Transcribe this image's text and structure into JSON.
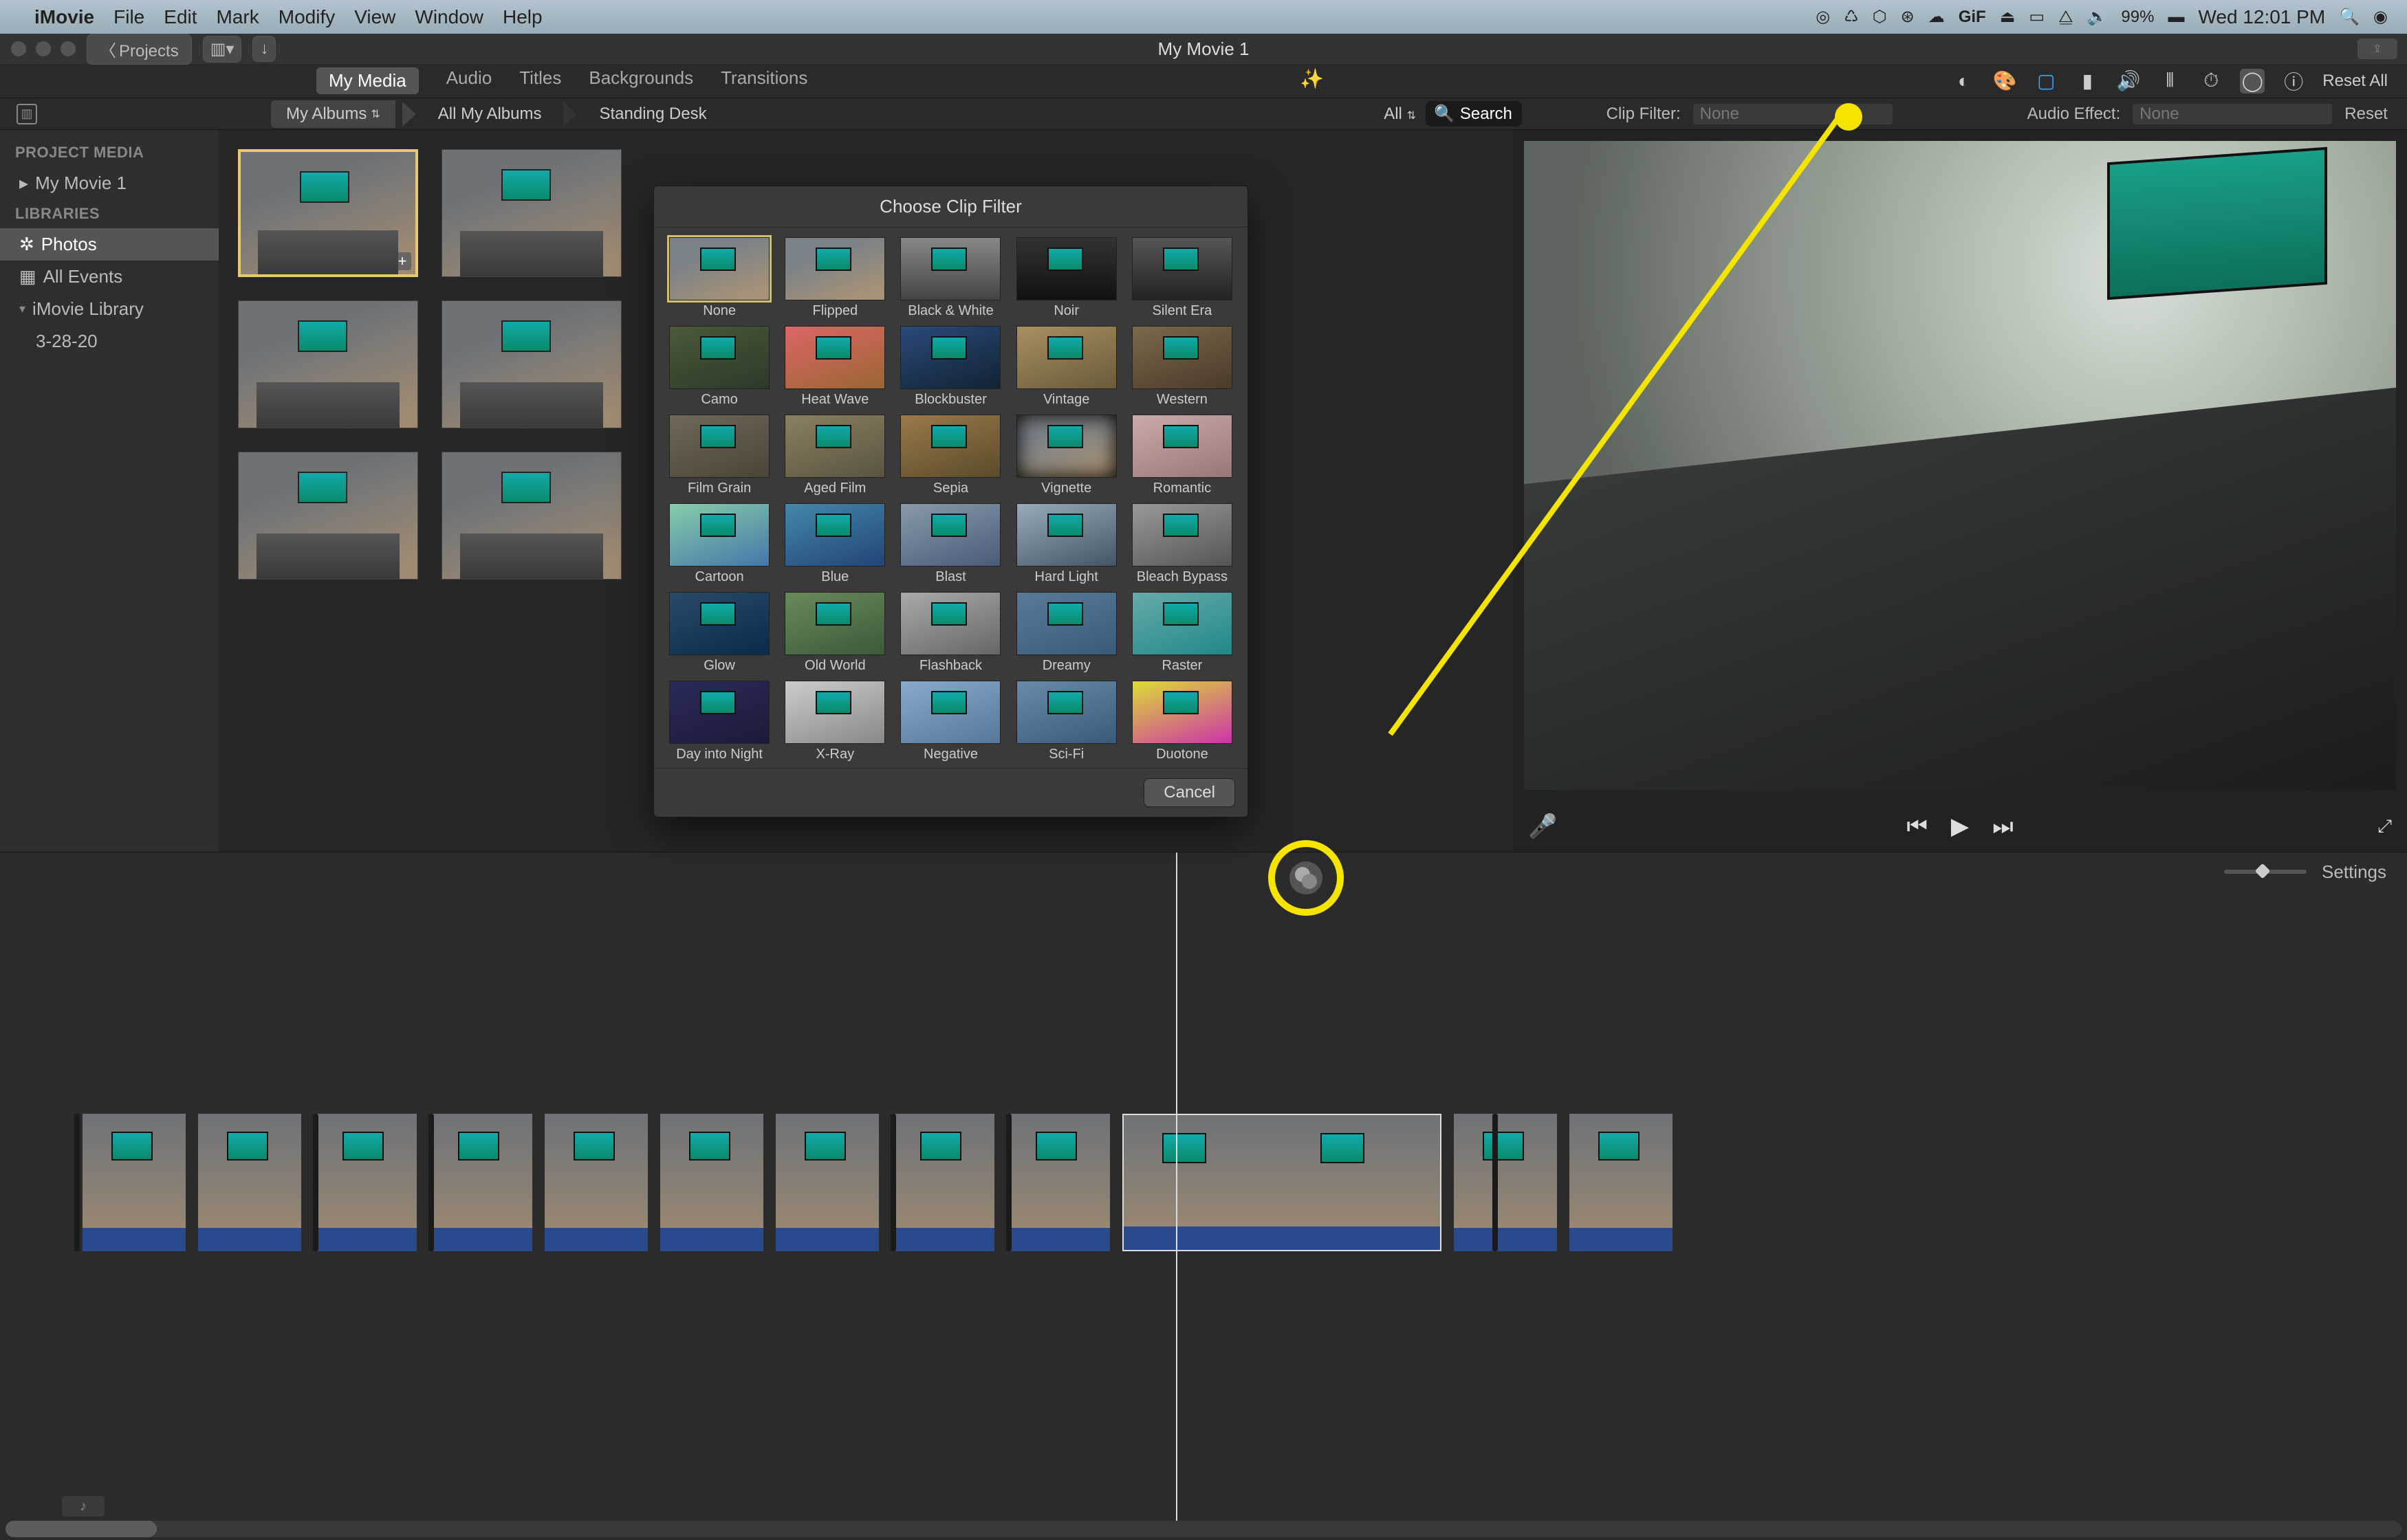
{
  "menubar": {
    "app": "iMovie",
    "items": [
      "File",
      "Edit",
      "Mark",
      "Modify",
      "View",
      "Window",
      "Help"
    ],
    "right": {
      "gif": "GiF",
      "battery": "99%",
      "clock": "Wed 12:01 PM"
    }
  },
  "titlebar": {
    "projects": "Projects",
    "title": "My Movie 1"
  },
  "tabs": [
    "My Media",
    "Audio",
    "Titles",
    "Backgrounds",
    "Transitions"
  ],
  "active_tab": "My Media",
  "reset_all": "Reset All",
  "breadcrumb": {
    "albums": "My Albums",
    "all": "All My Albums",
    "current": "Standing Desk",
    "filter": "All",
    "search_placeholder": "Search"
  },
  "fx": {
    "clip_label": "Clip Filter:",
    "clip_value": "None",
    "audio_label": "Audio Effect:",
    "audio_value": "None",
    "reset": "Reset"
  },
  "sidebar": {
    "project_media_hd": "PROJECT MEDIA",
    "project": "My Movie 1",
    "libraries_hd": "LIBRARIES",
    "photos": "Photos",
    "all_events": "All Events",
    "imovie_lib": "iMovie Library",
    "event": "3-28-20"
  },
  "modal": {
    "title": "Choose Clip Filter",
    "cancel": "Cancel",
    "filters": [
      {
        "name": "None",
        "cls": "",
        "sel": true
      },
      {
        "name": "Flipped",
        "cls": "t-flipped"
      },
      {
        "name": "Black & White",
        "cls": "t-bw"
      },
      {
        "name": "Noir",
        "cls": "t-noir"
      },
      {
        "name": "Silent Era",
        "cls": "t-silent"
      },
      {
        "name": "Camo",
        "cls": "t-camo"
      },
      {
        "name": "Heat Wave",
        "cls": "t-heat"
      },
      {
        "name": "Blockbuster",
        "cls": "t-block"
      },
      {
        "name": "Vintage",
        "cls": "t-vintage"
      },
      {
        "name": "Western",
        "cls": "t-western"
      },
      {
        "name": "Film Grain",
        "cls": "t-grain"
      },
      {
        "name": "Aged Film",
        "cls": "t-aged"
      },
      {
        "name": "Sepia",
        "cls": "t-sepia"
      },
      {
        "name": "Vignette",
        "cls": "t-vig"
      },
      {
        "name": "Romantic",
        "cls": "t-rom"
      },
      {
        "name": "Cartoon",
        "cls": "t-cartoon"
      },
      {
        "name": "Blue",
        "cls": "t-blue"
      },
      {
        "name": "Blast",
        "cls": "t-blast"
      },
      {
        "name": "Hard Light",
        "cls": "t-hard"
      },
      {
        "name": "Bleach Bypass",
        "cls": "t-bleach"
      },
      {
        "name": "Glow",
        "cls": "t-glow"
      },
      {
        "name": "Old World",
        "cls": "t-old"
      },
      {
        "name": "Flashback",
        "cls": "t-flash"
      },
      {
        "name": "Dreamy",
        "cls": "t-dream"
      },
      {
        "name": "Raster",
        "cls": "t-raster"
      },
      {
        "name": "Day into Night",
        "cls": "t-day"
      },
      {
        "name": "X-Ray",
        "cls": "t-xray"
      },
      {
        "name": "Negative",
        "cls": "t-neg"
      },
      {
        "name": "Sci-Fi",
        "cls": "t-scifi"
      },
      {
        "name": "Duotone",
        "cls": "t-duo"
      }
    ]
  },
  "timeline": {
    "settings": "Settings"
  }
}
